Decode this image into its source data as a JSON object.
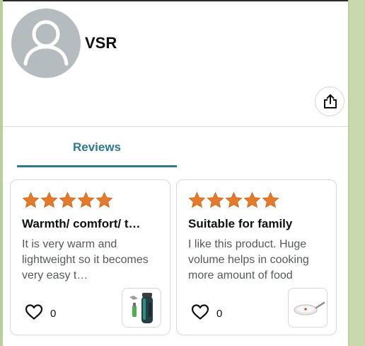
{
  "profile": {
    "name": "VSR",
    "avatar_icon": "user-silhouette-icon"
  },
  "actions": {
    "share_icon": "share-icon"
  },
  "tabs": [
    {
      "label": "Reviews",
      "active": true
    }
  ],
  "reviews": [
    {
      "rating": 5,
      "title": "Warmth/ comfort/ t…",
      "body": "It is very warm and lightweight so it becomes very easy t…",
      "likes": "0",
      "thumbnail_icon": "thermos-bottle-product-image"
    },
    {
      "rating": 5,
      "title": "Suitable for family",
      "body": "I like this product. Huge volume helps in cooking more amount of food",
      "likes": "0",
      "thumbnail_icon": "frying-pan-product-image"
    }
  ],
  "colors": {
    "accent": "#2c7a8c",
    "star": "#e47b2c",
    "background": "#b9cf99"
  }
}
